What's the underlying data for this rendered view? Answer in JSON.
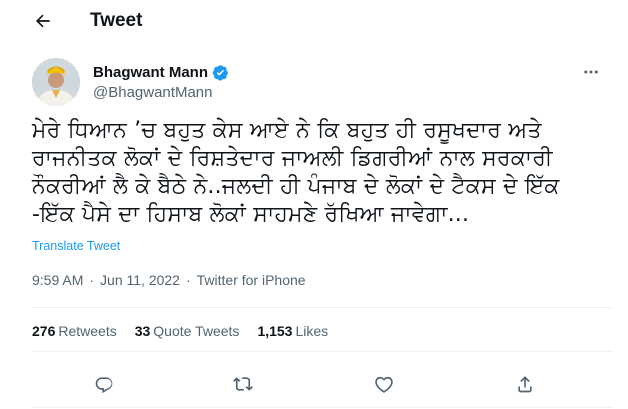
{
  "header": {
    "back_icon": "arrow-left-icon",
    "title": "Tweet"
  },
  "author": {
    "display_name": "Bhagwant Mann",
    "handle": "@BhagwantMann",
    "verified_icon": "verified-badge-icon",
    "verified_color": "#1d9bf0"
  },
  "tweet": {
    "lines": [
      "ਮੇਰੇ ਧਿਆਨ ’ਚ ਬਹੁਤ ਕੇਸ ਆਏ ਨੇ ਕਿ ਬਹੁਤ ਹੀ ਰਸੂਖਦਾਰ ਅਤੇ",
      "ਰਾਜਨੀਤਕ ਲੋਕਾਂ ਦੇ ਰਿਸ਼ਤੇਦਾਰ ਜਾਅਲੀ ਡਿਗਰੀਆਂ ਨਾਲ ਸਰਕਾਰੀ",
      "ਨੌਕਰੀਆਂ ਲੈ ਕੇ ਬੈਠੇ ਨੇ..ਜਲਦੀ ਹੀ ਪੰਜਾਬ ਦੇ ਲੋਕਾਂ ਦੇ ਟੈਕਸ ਦੇ ਇੱਕ",
      "-ਇੱਕ ਪੈਸੇ ਦਾ ਹਿਸਾਬ ਲੋਕਾਂ ਸਾਹਮਣੇ ਰੱਖਿਆ ਜਾਵੇਗਾ..."
    ],
    "translate_label": "Translate Tweet",
    "time": "9:59 AM",
    "date": "Jun 11, 2022",
    "source": "Twitter for iPhone",
    "separator": "·"
  },
  "stats": {
    "retweets_count": "276",
    "retweets_label": "Retweets",
    "quotes_count": "33",
    "quotes_label": "Quote Tweets",
    "likes_count": "1,153",
    "likes_label": "Likes"
  },
  "actions": {
    "reply_icon": "reply-icon",
    "retweet_icon": "retweet-icon",
    "like_icon": "heart-icon",
    "share_icon": "share-icon",
    "more_icon": "more-horizontal-icon"
  },
  "colors": {
    "text": "#0f1419",
    "secondary": "#536471",
    "link": "#1d9bf0",
    "divider": "#eff3f4"
  }
}
